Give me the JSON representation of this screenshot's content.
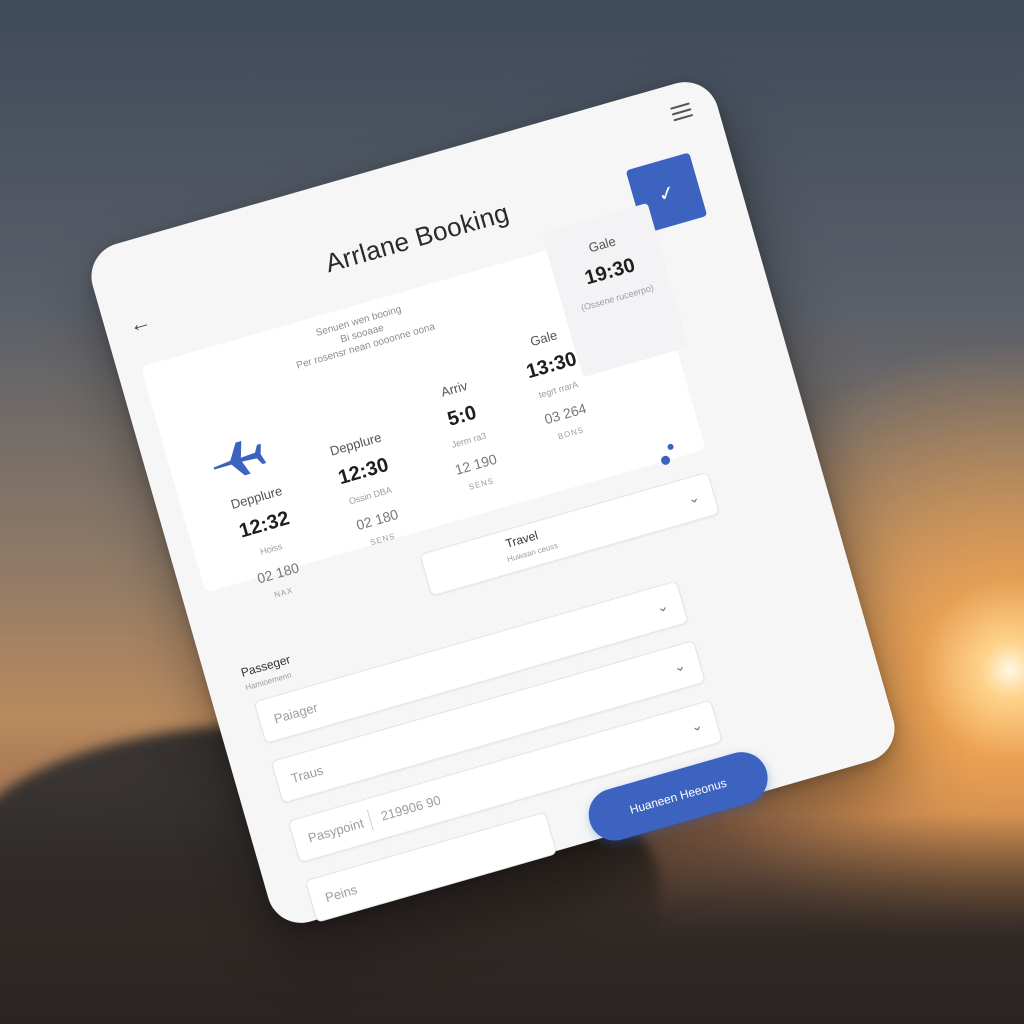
{
  "header": {
    "title": "Arrlane Booking"
  },
  "panel": {
    "subtitle_lines": [
      "Senuen wen booing",
      "Bi sooaae",
      "Per rosensr nean oooonne oona"
    ],
    "columns": [
      {
        "label": "Depplure",
        "time": "12:32",
        "sub": "Hoiss",
        "num": "02 180",
        "tag": "NAX"
      },
      {
        "label": "Depplure",
        "time": "12:30",
        "sub": "Ossin DBA",
        "num": "02 180",
        "tag": "SENS"
      },
      {
        "label": "Arriv",
        "time": "5:0",
        "sub": "Jerm ra3",
        "num": "12 190",
        "tag": "SENS"
      },
      {
        "label": "Gale",
        "time": "13:30",
        "sub": "tegrt rrarA",
        "num": "03 264",
        "tag": "BONS"
      }
    ],
    "gate": {
      "label": "Gale",
      "time": "19:30",
      "sub": "(Ossene ruceerpo)"
    }
  },
  "travel": {
    "label": "Travel",
    "sub": "Huwaan ceuss"
  },
  "passenger_section": {
    "label": "Passeger",
    "sub": "Hamioemenn"
  },
  "fields": [
    {
      "placeholder": "Paiager",
      "value": ""
    },
    {
      "placeholder": "Traus",
      "value": ""
    },
    {
      "placeholder": "Pasypoint",
      "value": "219906 90"
    },
    {
      "placeholder": "Peins",
      "value": ""
    }
  ],
  "submit": {
    "label": "Huaneen Heeonus"
  },
  "colors": {
    "accent": "#3d63c0",
    "card": "#f6f6f7"
  },
  "icons": [
    "menu-icon",
    "back-arrow-icon",
    "check-icon",
    "airplane-icon",
    "chevron-down-icon"
  ]
}
